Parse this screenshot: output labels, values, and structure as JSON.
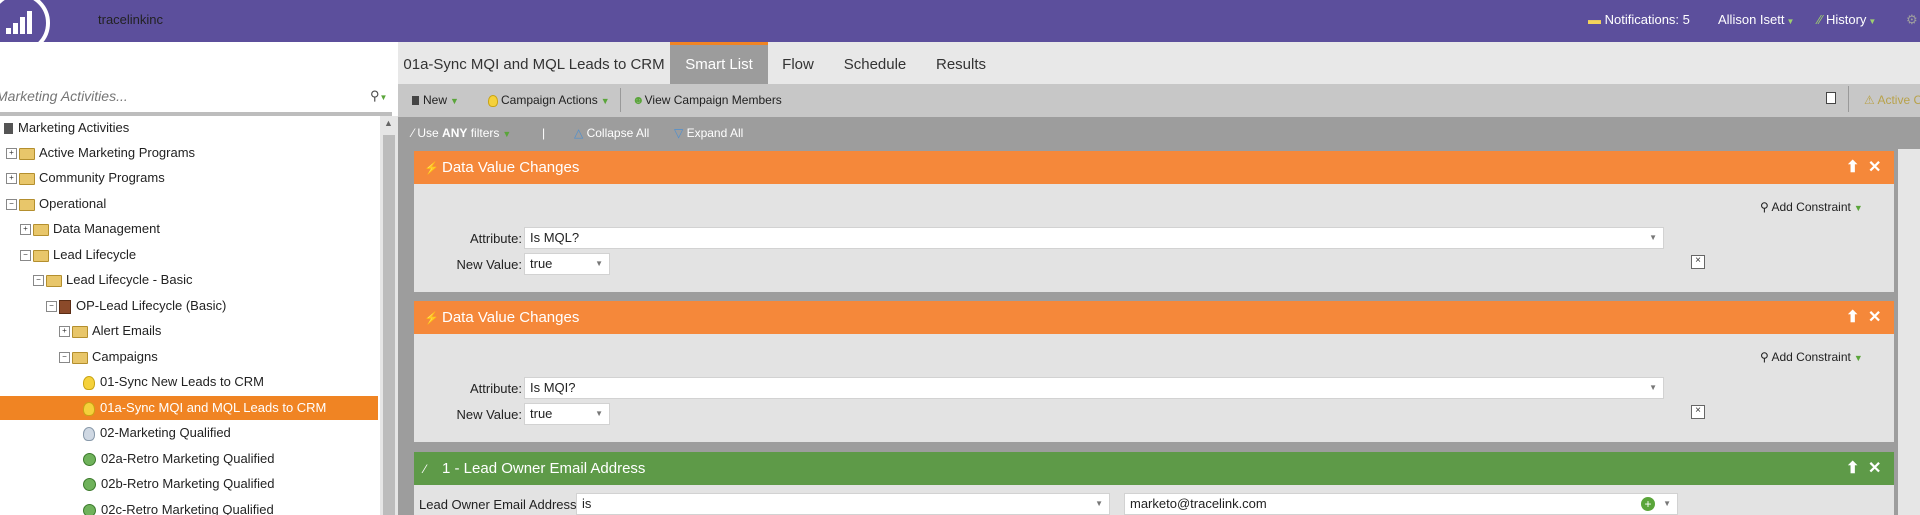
{
  "topbar": {
    "org_name": "tracelinkinc",
    "notifications": "Notifications: 5",
    "user": "Allison Isett",
    "history": "History"
  },
  "left": {
    "search_placeholder": "Marketing Activities...",
    "tree": [
      {
        "label": "Marketing Activities",
        "icon": "root-icon"
      },
      {
        "label": "Active Marketing Programs",
        "icon": "folder-icon"
      },
      {
        "label": "Community Programs",
        "icon": "folder-icon"
      },
      {
        "label": "Operational",
        "icon": "folder-icon"
      },
      {
        "label": "Data Management",
        "icon": "folder-icon"
      },
      {
        "label": "Lead Lifecycle",
        "icon": "folder-icon"
      },
      {
        "label": "Lead Lifecycle - Basic",
        "icon": "folder-icon"
      },
      {
        "label": "OP-Lead Lifecycle (Basic)",
        "icon": "program-icon"
      },
      {
        "label": "Alert Emails",
        "icon": "folder-icon"
      },
      {
        "label": "Campaigns",
        "icon": "folder-icon"
      },
      {
        "label": "01-Sync New Leads to CRM",
        "icon": "campaign-icon"
      },
      {
        "label": "01a-Sync MQI and MQL Leads to CRM",
        "icon": "campaign-icon"
      },
      {
        "label": "02-Marketing Qualified",
        "icon": "campaign-inactive-icon"
      },
      {
        "label": "02a-Retro Marketing Qualified",
        "icon": "batch-campaign-icon"
      },
      {
        "label": "02b-Retro Marketing Qualified",
        "icon": "batch-campaign-icon"
      },
      {
        "label": "02c-Retro Marketing Qualified",
        "icon": "batch-campaign-icon"
      }
    ]
  },
  "tabs": {
    "campaign": "01a-Sync MQI and MQL Leads to CRM",
    "smart_list": "Smart List",
    "flow": "Flow",
    "schedule": "Schedule",
    "results": "Results"
  },
  "toolbar": {
    "new": "New",
    "campaign_actions": "Campaign Actions",
    "view_members": "View Campaign Members",
    "active": "Active C"
  },
  "subbar": {
    "use_prefix": "Use ",
    "use_any": "ANY",
    "use_suffix": " filters",
    "separator": "|",
    "collapse": "Collapse All",
    "expand": "Expand All"
  },
  "filters": [
    {
      "title": "Data Value Changes",
      "add_constraint": "Add Constraint",
      "attr_label": "Attribute:",
      "attr_value": "Is MQL?",
      "new_label": "New Value:",
      "new_value": "true"
    },
    {
      "title": "Data Value Changes",
      "add_constraint": "Add Constraint",
      "attr_label": "Attribute:",
      "attr_value": "Is MQI?",
      "new_label": "New Value:",
      "new_value": "true"
    },
    {
      "title": "1 - Lead Owner Email Address",
      "field_label": "Lead Owner Email Address:",
      "operator": "is",
      "value": "marketo@tracelink.com"
    }
  ],
  "colors": {
    "header": "#5c4f9c",
    "trigger": "#f5883a",
    "filter": "#5e9a48",
    "selected": "#f08423"
  }
}
